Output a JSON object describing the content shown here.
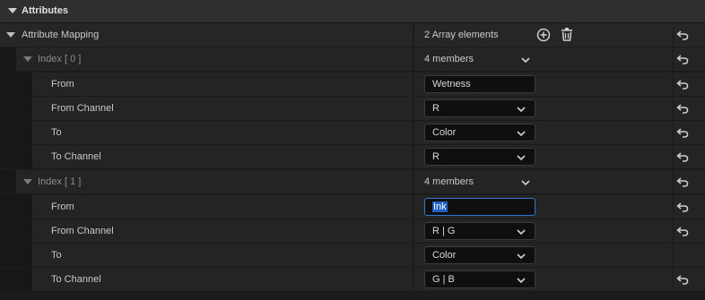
{
  "section": {
    "title": "Attributes"
  },
  "mapping": {
    "label": "Attribute Mapping",
    "count": "2 Array elements",
    "add_icon": "plus-circle-icon",
    "delete_icon": "trash-icon"
  },
  "items": [
    {
      "index_label": "Index [ 0 ]",
      "members": "4 members",
      "from_label": "From",
      "from_value": "Wetness",
      "from_channel_label": "From Channel",
      "from_channel_value": "R",
      "to_label": "To",
      "to_value": "Color",
      "to_channel_label": "To Channel",
      "to_channel_value": "R"
    },
    {
      "index_label": "Index [ 1 ]",
      "members": "4 members",
      "from_label": "From",
      "from_value": "Ink",
      "from_channel_label": "From Channel",
      "from_channel_value": "R | G",
      "to_label": "To",
      "to_value": "Color",
      "to_channel_label": "To Channel",
      "to_channel_value": "G | B"
    }
  ],
  "icons": {
    "reset": "reset-arrow-icon",
    "expand": "triangle-down-icon",
    "dropdown": "chevron-down-icon"
  }
}
